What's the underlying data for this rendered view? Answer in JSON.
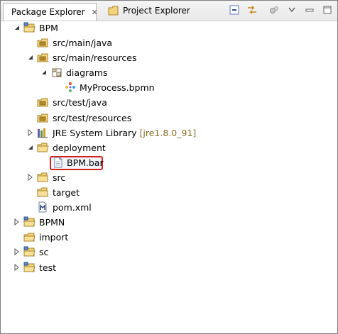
{
  "tabs": [
    {
      "label": "Package Explorer",
      "active": true
    },
    {
      "label": "Project Explorer",
      "active": false
    }
  ],
  "toolbar": {
    "buttons": [
      "collapse-all-icon",
      "link-with-editor-icon",
      "focus-icon",
      "view-menu-icon",
      "minimize-icon",
      "maximize-icon"
    ]
  },
  "tree": {
    "rows": [
      {
        "label": "BPM",
        "icon": "project-folder-icon",
        "twisty": "expanded",
        "level": 0
      },
      {
        "label": "src/main/java",
        "icon": "source-folder-icon",
        "twisty": "none",
        "level": 1
      },
      {
        "label": "src/main/resources",
        "icon": "source-folder-icon",
        "twisty": "expanded",
        "level": 1
      },
      {
        "label": "diagrams",
        "icon": "package-icon",
        "twisty": "expanded",
        "level": 2
      },
      {
        "label": "MyProcess.bpmn",
        "icon": "bpmn-file-icon",
        "twisty": "none",
        "level": 3
      },
      {
        "label": "src/test/java",
        "icon": "source-folder-icon",
        "twisty": "none",
        "level": 1
      },
      {
        "label": "src/test/resources",
        "icon": "source-folder-icon",
        "twisty": "none",
        "level": 1
      },
      {
        "label": "JRE System Library",
        "decoration": "[jre1.8.0_91]",
        "icon": "library-icon",
        "twisty": "collapsed",
        "level": 1
      },
      {
        "label": "deployment",
        "icon": "folder-icon",
        "twisty": "expanded",
        "level": 1
      },
      {
        "label": "BPM.bar",
        "icon": "file-icon",
        "twisty": "none",
        "level": 2,
        "highlighted": true
      },
      {
        "label": "src",
        "icon": "folder-icon",
        "twisty": "collapsed",
        "level": 1
      },
      {
        "label": "target",
        "icon": "folder-icon",
        "twisty": "none",
        "level": 1
      },
      {
        "label": "pom.xml",
        "icon": "maven-file-icon",
        "twisty": "none",
        "level": 1
      },
      {
        "label": "BPMN",
        "icon": "project-folder-icon",
        "twisty": "collapsed",
        "level": 0
      },
      {
        "label": "import",
        "icon": "project-folder-icon",
        "twisty": "none",
        "level": 0
      },
      {
        "label": "sc",
        "icon": "project-folder-icon",
        "twisty": "collapsed",
        "level": 0
      },
      {
        "label": "test",
        "icon": "project-folder-icon",
        "twisty": "collapsed",
        "level": 0
      }
    ]
  }
}
